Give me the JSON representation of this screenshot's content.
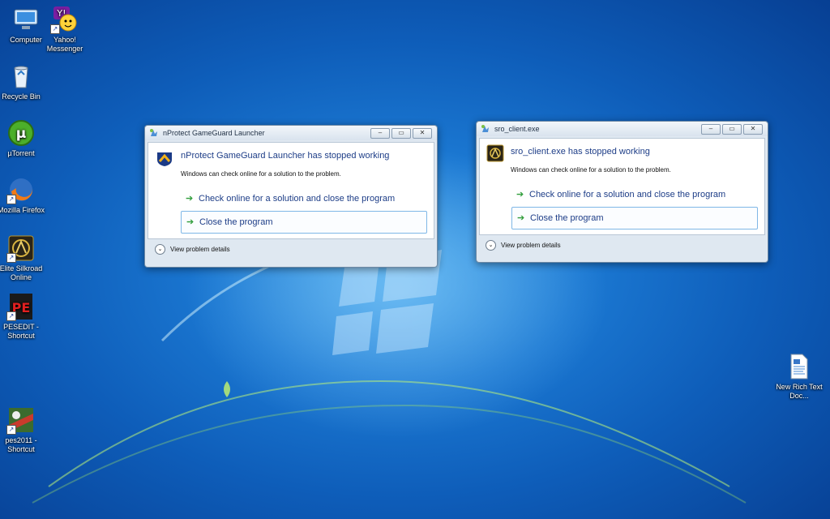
{
  "desktop": {
    "icons": [
      {
        "label": "Computer",
        "icon": "computer-icon",
        "shortcut": false
      },
      {
        "label": "Yahoo! Messenger",
        "icon": "yahoo-messenger-icon",
        "shortcut": true
      },
      {
        "label": "Recycle Bin",
        "icon": "recycle-bin-icon",
        "shortcut": false
      },
      {
        "label": "µTorrent",
        "icon": "utorrent-icon",
        "shortcut": false
      },
      {
        "label": "Mozilla Firefox",
        "icon": "firefox-icon",
        "shortcut": true
      },
      {
        "label": "Elite Silkroad Online",
        "icon": "silkroad-icon",
        "shortcut": true
      },
      {
        "label": "PESEDIT - Shortcut",
        "icon": "pesedit-icon",
        "shortcut": true
      },
      {
        "label": "pes2011 - Shortcut",
        "icon": "pes2011-icon",
        "shortcut": true
      },
      {
        "label": "New Rich Text Doc...",
        "icon": "rich-text-document-icon",
        "shortcut": false
      }
    ]
  },
  "dialogs": [
    {
      "title": "nProtect GameGuard Launcher",
      "headline": "nProtect GameGuard Launcher has stopped working",
      "subtext": "Windows can check online for a solution to the problem.",
      "option1": "Check online for a solution and close the program",
      "option2": "Close the program",
      "details": "View problem details",
      "app_icon": "gameguard-icon"
    },
    {
      "title": "sro_client.exe",
      "headline": "sro_client.exe has stopped working",
      "subtext": "Windows can check online for a solution to the problem.",
      "option1": "Check online for a solution and close the program",
      "option2": "Close the program",
      "details": "View problem details",
      "app_icon": "silkroad-icon"
    }
  ],
  "glyphs": {
    "arrow": "➔",
    "chevron": "⌄",
    "minimize": "–",
    "maximize": "▭",
    "close": "✕"
  },
  "colors": {
    "accent": "#1d3d87",
    "arrow_green": "#2f9d3a",
    "desktop_blue": "#1b78d2"
  }
}
